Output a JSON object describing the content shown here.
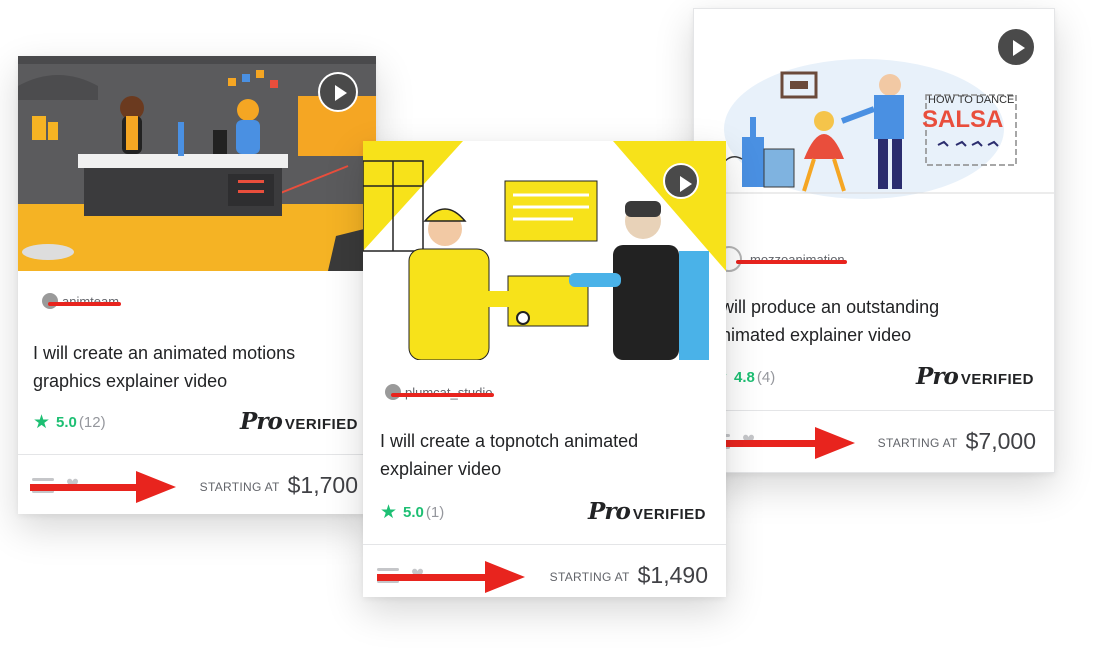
{
  "cards": [
    {
      "seller": "animteam",
      "title_line1": "I will create an animated motions",
      "title_line2": "graphics explainer video",
      "rating": "5.0",
      "reviews": "(12)",
      "pro": "Pro",
      "verified": "VERIFIED",
      "starting_label": "STARTING AT",
      "price": "$1,700"
    },
    {
      "seller": "plumcat_studio",
      "title_line1": "I will create a topnotch animated",
      "title_line2": "explainer video",
      "rating": "5.0",
      "reviews": "(1)",
      "pro": "Pro",
      "verified": "VERIFIED",
      "starting_label": "STARTING AT",
      "price": "$1,490"
    },
    {
      "seller": "mozzoanimation",
      "title_line1": "I will produce an outstanding",
      "title_line2": "animated explainer video",
      "rating": "4.8",
      "reviews": "(4)",
      "pro": "Pro",
      "verified": "VERIFIED",
      "starting_label": "STARTING AT",
      "price": "$7,000"
    }
  ],
  "thumb3_text": {
    "line1": "HOW TO DANCE",
    "line2": "SALSA"
  },
  "icons": {
    "play": "play-icon",
    "star": "★",
    "heart": "♥",
    "menu": "menu-icon",
    "arrow": "red-arrow-icon"
  },
  "colors": {
    "rating_green": "#1dbf73",
    "annotation_red": "#e8241e",
    "price_text": "#404145"
  }
}
